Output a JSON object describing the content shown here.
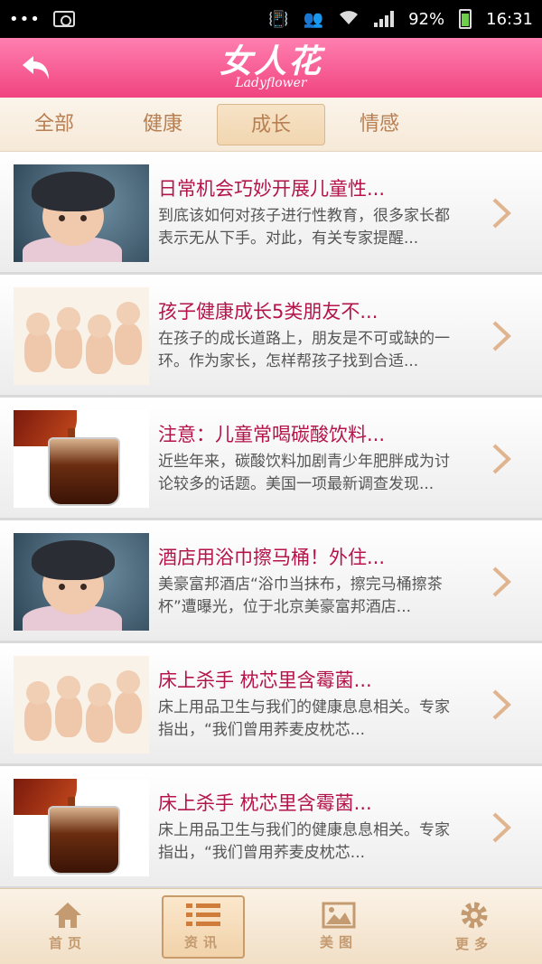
{
  "status_bar": {
    "battery": "92%",
    "time": "16:31"
  },
  "header": {
    "logo_text": "女人花",
    "logo_sub": "Ladyflower"
  },
  "tabs": [
    {
      "label": "全部"
    },
    {
      "label": "健康"
    },
    {
      "label": "成长",
      "active": true
    },
    {
      "label": "情感"
    }
  ],
  "articles": [
    {
      "title": "日常机会巧妙开展儿童性...",
      "summary": "到底该如何对孩子进行性教育，很多家长都表示无从下手。对此，有关专家提醒...",
      "image": "baby-portrait"
    },
    {
      "title": "孩子健康成长5类朋友不...",
      "summary": "在孩子的成长道路上，朋友是不可或缺的一环。作为家长，怎样帮孩子找到合适...",
      "image": "babies-group"
    },
    {
      "title": "注意：儿童常喝碳酸饮料...",
      "summary": "近些年来，碳酸饮料加剧青少年肥胖成为讨论较多的话题。美国一项最新调查发现...",
      "image": "cola-glass"
    },
    {
      "title": "酒店用浴巾擦马桶！外住...",
      "summary": "美豪富邦酒店“浴巾当抹布，擦完马桶擦茶杯”遭曝光，位于北京美豪富邦酒店...",
      "image": "baby-portrait"
    },
    {
      "title": "床上杀手 枕芯里含霉菌...",
      "summary": "床上用品卫生与我们的健康息息相关。专家指出，“我们曾用荞麦皮枕芯...",
      "image": "babies-group"
    },
    {
      "title": "床上杀手 枕芯里含霉菌...",
      "summary": "床上用品卫生与我们的健康息息相关。专家指出，“我们曾用荞麦皮枕芯...",
      "image": "cola-glass"
    }
  ],
  "bottom_nav": [
    {
      "label": "首页",
      "icon": "home-icon"
    },
    {
      "label": "资讯",
      "icon": "list-icon",
      "active": true
    },
    {
      "label": "美图",
      "icon": "picture-icon"
    },
    {
      "label": "更多",
      "icon": "gear-icon"
    }
  ],
  "colors": {
    "header": "#f0447f",
    "title": "#b5144a",
    "tab_text": "#b77f52"
  }
}
